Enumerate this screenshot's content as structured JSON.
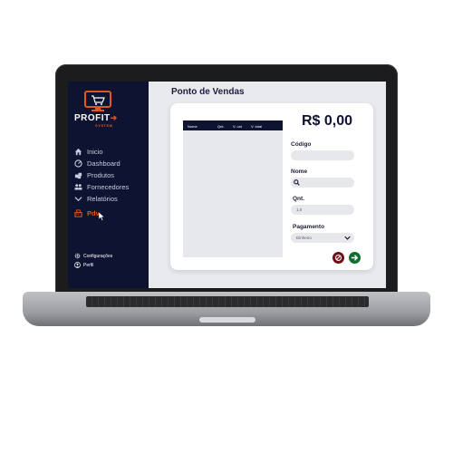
{
  "sidebar": {
    "logo_text": "PROFIT",
    "logo_sub": "SYSTEM",
    "items": [
      {
        "label": "Inicio",
        "icon": "home-icon"
      },
      {
        "label": "Dashboard",
        "icon": "dashboard-icon"
      },
      {
        "label": "Produtos",
        "icon": "products-icon"
      },
      {
        "label": "Fornecedores",
        "icon": "suppliers-icon"
      },
      {
        "label": "Relatórios",
        "icon": "chevron-down-icon"
      },
      {
        "label": "Pdv",
        "icon": "cash-register-icon",
        "active": true
      }
    ],
    "bottom": [
      {
        "label": "Configurações",
        "icon": "gear-icon"
      },
      {
        "label": "Perfil",
        "icon": "user-icon"
      }
    ]
  },
  "main": {
    "title": "Ponto de Vendas",
    "table_columns": [
      "Nome",
      "Qnt.",
      "V. uni",
      "V. total"
    ],
    "total": "R$ 0,00",
    "fields": {
      "codigo_label": "Código",
      "nome_label": "Nome",
      "qnt_label": "Qnt.",
      "qnt_value": "1,0",
      "pagamento_label": "Pagamento",
      "pagamento_value": "Dinheiro"
    }
  },
  "colors": {
    "sidebar": "#0d1330",
    "accent": "#e2561f",
    "cancel": "#6e0f1a",
    "confirm": "#0f6f2c"
  }
}
